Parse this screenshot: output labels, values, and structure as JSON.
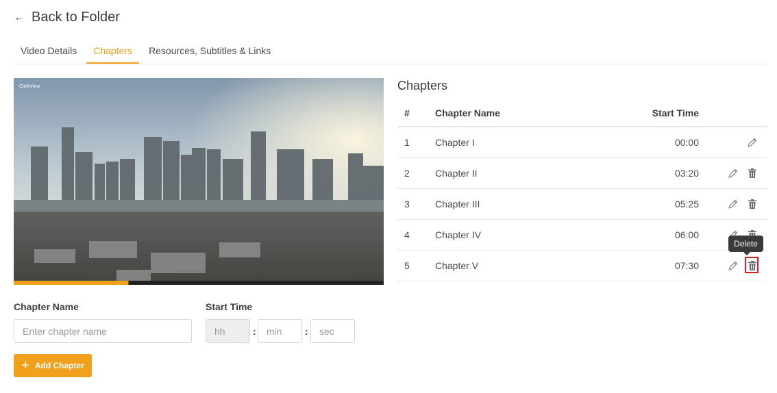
{
  "header": {
    "back_label": "Back to Folder"
  },
  "tabs": [
    {
      "label": "Video Details",
      "active": false
    },
    {
      "label": "Chapters",
      "active": true
    },
    {
      "label": "Resources, Subtitles & Links",
      "active": false
    }
  ],
  "player": {
    "watermark": "ClickView",
    "progress_fraction": 0.31,
    "progress_color": "#f0a01a"
  },
  "form": {
    "chapter_name_label": "Chapter Name",
    "chapter_name_placeholder": "Enter chapter name",
    "start_time_label": "Start Time",
    "hh_placeholder": "hh",
    "min_placeholder": "min",
    "sec_placeholder": "sec",
    "colon": ":",
    "add_button_label": "Add Chapter"
  },
  "chapters": {
    "title": "Chapters",
    "headers": {
      "num": "#",
      "name": "Chapter Name",
      "start": "Start Time"
    },
    "rows": [
      {
        "num": "1",
        "name": "Chapter I",
        "start": "00:00"
      },
      {
        "num": "2",
        "name": "Chapter II",
        "start": "03:20"
      },
      {
        "num": "3",
        "name": "Chapter III",
        "start": "05:25"
      },
      {
        "num": "4",
        "name": "Chapter IV",
        "start": "06:00"
      },
      {
        "num": "5",
        "name": "Chapter V",
        "start": "07:30"
      }
    ]
  },
  "tooltip": {
    "label": "Delete"
  },
  "colors": {
    "accent": "#f0a01a",
    "highlight": "#e01818"
  }
}
